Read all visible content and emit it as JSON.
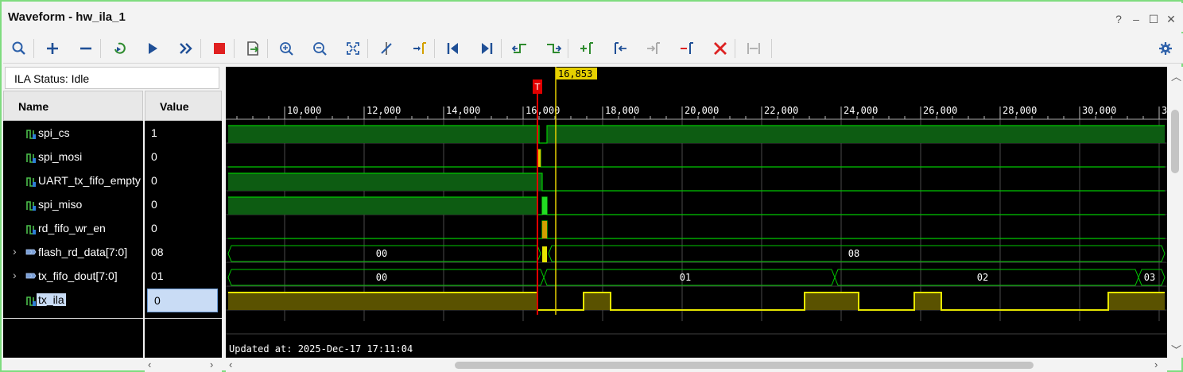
{
  "window": {
    "title": "Waveform - hw_ila_1",
    "controls": [
      "?",
      "–",
      "☐",
      "✕"
    ]
  },
  "toolbar": {
    "buttons": [
      {
        "name": "search-icon",
        "enabled": true
      },
      {
        "name": "add-icon",
        "enabled": true
      },
      {
        "name": "remove-icon",
        "enabled": true
      },
      {
        "name": "run-trigger-immediate-icon",
        "enabled": true
      },
      {
        "name": "run-trigger-icon",
        "enabled": true
      },
      {
        "name": "run-continuous-icon",
        "enabled": true
      },
      {
        "name": "stop-icon",
        "enabled": true
      },
      {
        "name": "export-icon",
        "enabled": true
      },
      {
        "name": "zoom-in-icon",
        "enabled": true
      },
      {
        "name": "zoom-out-icon",
        "enabled": true
      },
      {
        "name": "zoom-fit-icon",
        "enabled": true
      },
      {
        "name": "cursor-remove-icon",
        "enabled": true
      },
      {
        "name": "go-to-cursor-icon",
        "enabled": true
      },
      {
        "name": "go-to-time-zero-icon",
        "enabled": true
      },
      {
        "name": "go-to-last-time-icon",
        "enabled": true
      },
      {
        "name": "previous-transition-icon",
        "enabled": true
      },
      {
        "name": "next-transition-icon",
        "enabled": true
      },
      {
        "name": "add-marker-icon",
        "enabled": true
      },
      {
        "name": "previous-marker-icon",
        "enabled": true
      },
      {
        "name": "next-marker-icon",
        "enabled": false
      },
      {
        "name": "delete-marker-icon",
        "enabled": true
      },
      {
        "name": "delete-all-markers-icon",
        "enabled": true
      },
      {
        "name": "swap-cursors-icon",
        "enabled": false
      }
    ],
    "settings_icon": "gear-icon"
  },
  "ila_status": {
    "label": "ILA Status:",
    "value": "Idle"
  },
  "columns": {
    "name": "Name",
    "value": "Value"
  },
  "signals": [
    {
      "name": "spi_cs",
      "value": "1",
      "bus": false
    },
    {
      "name": "spi_mosi",
      "value": "0",
      "bus": false
    },
    {
      "name": "UART_tx_fifo_empty",
      "value": "0",
      "bus": false
    },
    {
      "name": "spi_miso",
      "value": "0",
      "bus": false
    },
    {
      "name": "rd_fifo_wr_en",
      "value": "0",
      "bus": false
    },
    {
      "name": "flash_rd_data[7:0]",
      "value": "08",
      "bus": true
    },
    {
      "name": "tx_fifo_dout[7:0]",
      "value": "01",
      "bus": true
    },
    {
      "name": "tx_ila",
      "value": "0",
      "bus": false,
      "selected": true
    }
  ],
  "waveform": {
    "axis_ticks": [
      "10,000",
      "12,000",
      "14,000",
      "16,000",
      "18,000",
      "20,000",
      "22,000",
      "24,000",
      "26,000",
      "28,000",
      "30,000",
      "3"
    ],
    "cursor_label": "16,853",
    "trigger_label": "T",
    "bus_values": {
      "flash_rd_data": [
        "00",
        "08"
      ],
      "tx_fifo_dout": [
        "00",
        "01",
        "02",
        "03"
      ]
    },
    "updated_text": "Updated at: 2025-Dec-17 17:11:04",
    "colors": {
      "high": "#0d5c12",
      "edge": "#00c800",
      "bus": "#00c800",
      "selected": "#e6e600",
      "trigger": "#e00000",
      "cursor": "#e6d000"
    }
  }
}
